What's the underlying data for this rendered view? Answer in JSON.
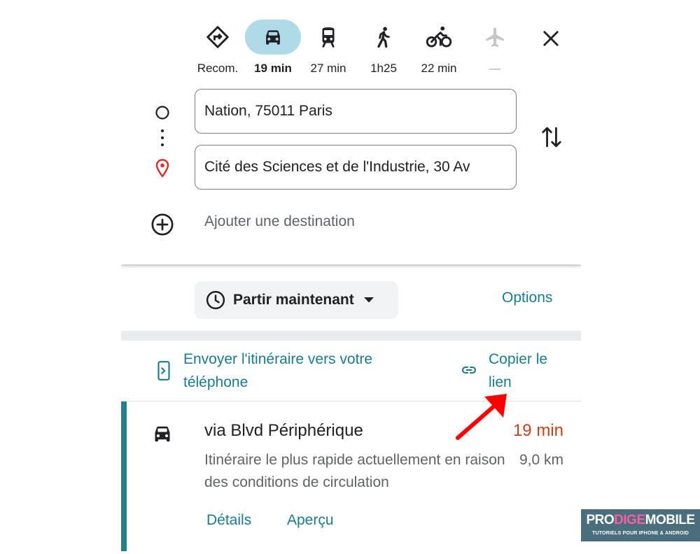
{
  "modes": [
    {
      "id": "recommended",
      "label": "Recom.",
      "icon": "directions-diamond-icon",
      "active": false
    },
    {
      "id": "car",
      "label": "19 min",
      "icon": "car-icon",
      "active": true
    },
    {
      "id": "transit",
      "label": "27 min",
      "icon": "train-icon",
      "active": false
    },
    {
      "id": "walk",
      "label": "1h25",
      "icon": "walking-icon",
      "active": false
    },
    {
      "id": "bike",
      "label": "22 min",
      "icon": "bicycle-icon",
      "active": false
    },
    {
      "id": "flight",
      "label": "—",
      "icon": "airplane-icon",
      "active": false,
      "disabled": true
    }
  ],
  "origin": {
    "value": "Nation, 75011 Paris"
  },
  "destination": {
    "value": "Cité des Sciences et de l'Industrie, 30 Av"
  },
  "add_destination_label": "Ajouter une destination",
  "depart": {
    "label": "Partir maintenant"
  },
  "options_label": "Options",
  "send_to_phone_label": "Envoyer l'itinéraire vers votre téléphone",
  "copy_link_label": "Copier le lien",
  "route": {
    "title": "via Blvd Périphérique",
    "time": "19 min",
    "description": "Itinéraire le plus rapide actuellement en raison des conditions de circulation",
    "distance": "9,0 km",
    "details_label": "Détails",
    "preview_label": "Aperçu"
  },
  "watermark": {
    "brand_a": "PRO",
    "brand_b": "DIGE",
    "brand_c": "MOBILE",
    "tagline": "TUTORIELS POUR IPHONE & ANDROID"
  },
  "colors": {
    "accent": "#1a7b8c",
    "active_mode_bg": "#aedbe7",
    "route_time": "#c5421a",
    "destination_pin": "#d93025",
    "annotation_arrow": "#ff0000"
  }
}
